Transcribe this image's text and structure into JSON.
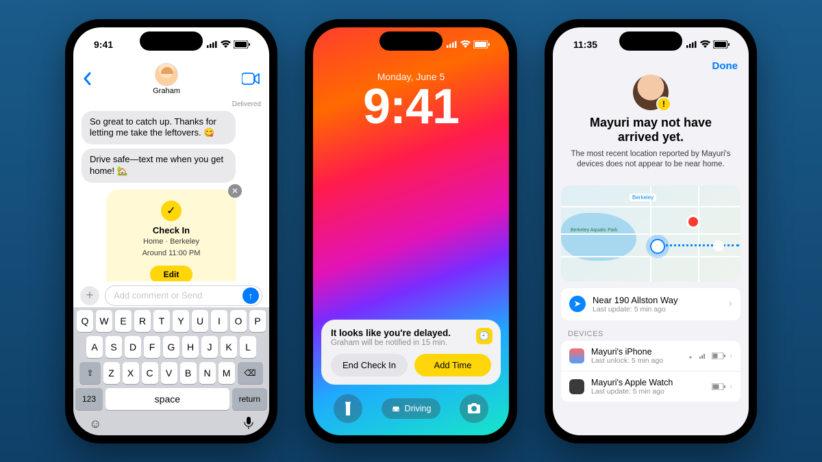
{
  "phone1": {
    "status_time": "9:41",
    "contact": "Graham",
    "delivered": "Delivered",
    "msg1": "So great to catch up. Thanks for letting me take the leftovers. 😋",
    "msg2": "Drive safe—text me when you get home! 🏡",
    "checkin": {
      "title": "Check In",
      "location": "Home · Berkeley",
      "eta": "Around 11:00 PM",
      "edit": "Edit"
    },
    "compose_placeholder": "Add comment or Send",
    "keyboard": {
      "row1": [
        "Q",
        "W",
        "E",
        "R",
        "T",
        "Y",
        "U",
        "I",
        "O",
        "P"
      ],
      "row2": [
        "A",
        "S",
        "D",
        "F",
        "G",
        "H",
        "J",
        "K",
        "L"
      ],
      "num_key": "123",
      "space": "space",
      "return": "return"
    }
  },
  "phone2": {
    "date": "Monday, June 5",
    "time": "9:41",
    "notif": {
      "title": "It looks like you're delayed.",
      "subtitle": "Graham will be notified in 15 min.",
      "end": "End Check In",
      "add": "Add Time"
    },
    "focus": "Driving"
  },
  "phone3": {
    "status_time": "11:35",
    "done": "Done",
    "title": "Mayuri may not have arrived yet.",
    "subtitle": "The most recent location reported by Mayuri's devices does not appear to be near home.",
    "map_labels": {
      "berkeley": "Berkeley",
      "park": "Berkeley Aquatic Park"
    },
    "location": {
      "line": "Near 190 Allston Way",
      "update": "Last update: 5 min ago"
    },
    "devices_header": "DEVICES",
    "devices": [
      {
        "name": "Mayuri's iPhone",
        "sub": "Last unlock: 5 min ago"
      },
      {
        "name": "Mayuri's Apple Watch",
        "sub": "Last update: 5 min ago"
      }
    ]
  }
}
